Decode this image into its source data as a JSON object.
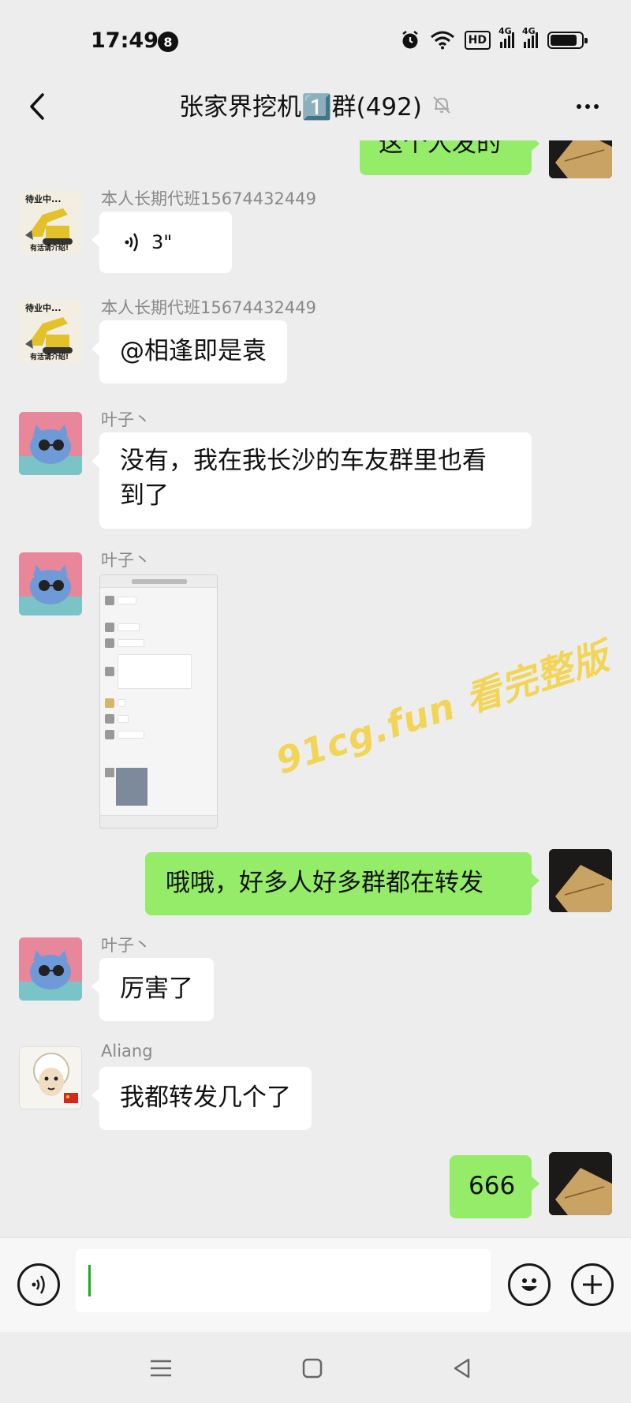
{
  "status_bar": {
    "time": "17:49",
    "notification_count": "8",
    "hd_label": "HD",
    "network_1": "4G",
    "network_2": "4G"
  },
  "header": {
    "title": "张家界挖机1️⃣群(492)",
    "back_icon": "chevron-left-icon",
    "mute_icon": "bell-off-icon",
    "more_icon": "more-dots-icon"
  },
  "messages": [
    {
      "side": "right",
      "type": "text",
      "text": "这个人发的",
      "partial": true
    },
    {
      "side": "left",
      "type": "voice",
      "sender": "本人长期代班15674432449",
      "duration": "3\""
    },
    {
      "side": "left",
      "type": "text",
      "sender": "本人长期代班15674432449",
      "text": "@相逢即是袁"
    },
    {
      "side": "left",
      "type": "text",
      "sender": "叶子丶",
      "text_line1": "没有，我在我长沙的车友群里也看",
      "text_line2": "到了"
    },
    {
      "side": "left",
      "type": "image",
      "sender": "叶子丶"
    },
    {
      "side": "right",
      "type": "text",
      "text": "哦哦，好多人好多群都在转发"
    },
    {
      "side": "left",
      "type": "text",
      "sender": "叶子丶",
      "text": "厉害了"
    },
    {
      "side": "left",
      "type": "text",
      "sender": "Aliang",
      "text": "我都转发几个了"
    },
    {
      "side": "right",
      "type": "text",
      "text": "666"
    }
  ],
  "watermark": "91cg.fun 看完整版",
  "avatar_texts": {
    "excavator_top": "待业中...",
    "excavator_bottom": "有活请介绍!"
  },
  "input_bar": {
    "voice_icon": "voice-mode-icon",
    "emoji_icon": "emoji-icon",
    "plus_icon": "plus-icon",
    "value": ""
  },
  "nav_bar": {
    "icons": [
      "menu-icon",
      "home-square-icon",
      "back-triangle-icon"
    ]
  },
  "colors": {
    "background": "#ededed",
    "bubble_self": "#95ec69",
    "bubble_other": "#ffffff",
    "watermark": "#f3d34a"
  }
}
